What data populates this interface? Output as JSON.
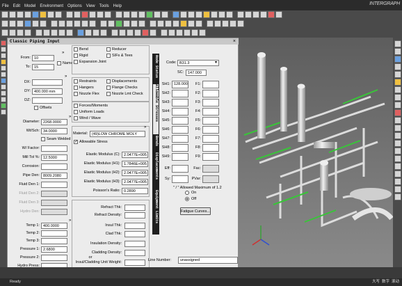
{
  "app": {
    "logo": "INTERGRAPH",
    "menus": [
      "File",
      "Edit",
      "Model",
      "Environment",
      "Options",
      "View",
      "Tools",
      "Help"
    ]
  },
  "panel": {
    "title": "Classic Piping Input",
    "close": "×"
  },
  "left": {
    "from_label": "From:",
    "from": "10",
    "to_label": "To:",
    "to": "15",
    "name_label": "Name",
    "dx_label": "DX:",
    "dx": "",
    "dy_label": "DY:",
    "dy": "400.000 mm",
    "dz_label": "DZ:",
    "dz": "",
    "offsets_label": "Offsets",
    "diameter_label": "Diameter:",
    "diameter": "2268.0000",
    "wt_label": "Wt/Sch:",
    "wt": "34.0000",
    "seam_label": "Seam Welded",
    "wifactor_label": "W/ Factor:",
    "wifactor": "",
    "milltol_label": "Mill Tol %:",
    "milltol": "12.5000",
    "corrosion_label": "Corrosion:",
    "corrosion": "",
    "pipeden_label": "Pipe Den:",
    "pipeden": "8009.2080",
    "fluid1_label": "Fluid Den 1:",
    "fluid1": "",
    "fluid2_label": "Fluid Den 2:",
    "fluid3_label": "Fluid Den 3:",
    "hydro_label": "Hydro Den:",
    "temp1_label": "Temp 1:",
    "temp1": "400.0000",
    "temp2_label": "Temp 2:",
    "temp3_label": "Temp 3:",
    "p1_label": "Pressure 1:",
    "p1": "2.6800",
    "p2_label": "Pressure 2:",
    "hydro_press_label": "Hydro Press:"
  },
  "mid": {
    "checks": [
      "Bend",
      "Reducer",
      "Rigid",
      "SIFs & Tees",
      "Expansion Joint",
      "Restraints",
      "Displacements",
      "Hangers",
      "Flange Checks",
      "Nozzle Flex",
      "Nozzle Lmt Check",
      "Forces/Moments",
      "Uniform Loads",
      "Wind / Wave"
    ],
    "material_label": "Material:",
    "material": "(49)LOW CHROME MOLY",
    "allowable_label": "Allowable Stress",
    "ec_label": "Elastic Modulus (C):",
    "ec": "2.0477E+005",
    "eh1_label": "Elastic Modulus (H1):",
    "eh1": "1.7846E+005",
    "eh2_label": "Elastic Modulus (H2):",
    "eh2": "2.0477E+005",
    "eh3_label": "Elastic Modulus (H3):",
    "eh3": "2.0477E+005",
    "poisson_label": "Poisson's Ratio:",
    "poisson": "0.2890",
    "refthk_label": "Refract Thk:",
    "refden_label": "Refract Density:",
    "insthk_label": "Insul Thk:",
    "cladthk_label": "Clad Thk:",
    "insden_label": "Insulation Density:",
    "cladden_label": "Cladding Density:",
    "or_label": "or",
    "insclad_label": "Insul/Cladding Unit Weight:"
  },
  "tabs": [
    "Node Status",
    "Allowable Stresses",
    "Bends",
    "Displacements",
    "Equipment Limits"
  ],
  "allow": {
    "code_label": "Code:",
    "code": "B31.3",
    "sc_label": "SC:",
    "sc": "147.000",
    "sh_labels": [
      "SH1:",
      "SH2:",
      "SH3:",
      "SH4:",
      "SH5:",
      "SH6:",
      "SH7:",
      "SH8:",
      "SH9:"
    ],
    "sh_values": [
      "128.000",
      "",
      "",
      "",
      "",
      "",
      "",
      "",
      ""
    ],
    "f_labels": [
      "F1:",
      "F2:",
      "F3:",
      "F4:",
      "F5:",
      "F6:",
      "F7:",
      "F8:",
      "F9:"
    ],
    "eff_label": "Eff:",
    "fac_label": "Fac:",
    "sy_label": "Sy:",
    "pvar_label": "PVar:",
    "allowed_max": "\" / \" Allowed Maximum of 1.2",
    "on_label": "On",
    "off_label": "Off",
    "fatigue_button": "Fatigue Curves...",
    "line_label": "Line Number:",
    "line": "unassigned"
  },
  "status": {
    "ready": "Ready",
    "r1": "大写",
    "r2": "数字",
    "r3": "滚动"
  }
}
